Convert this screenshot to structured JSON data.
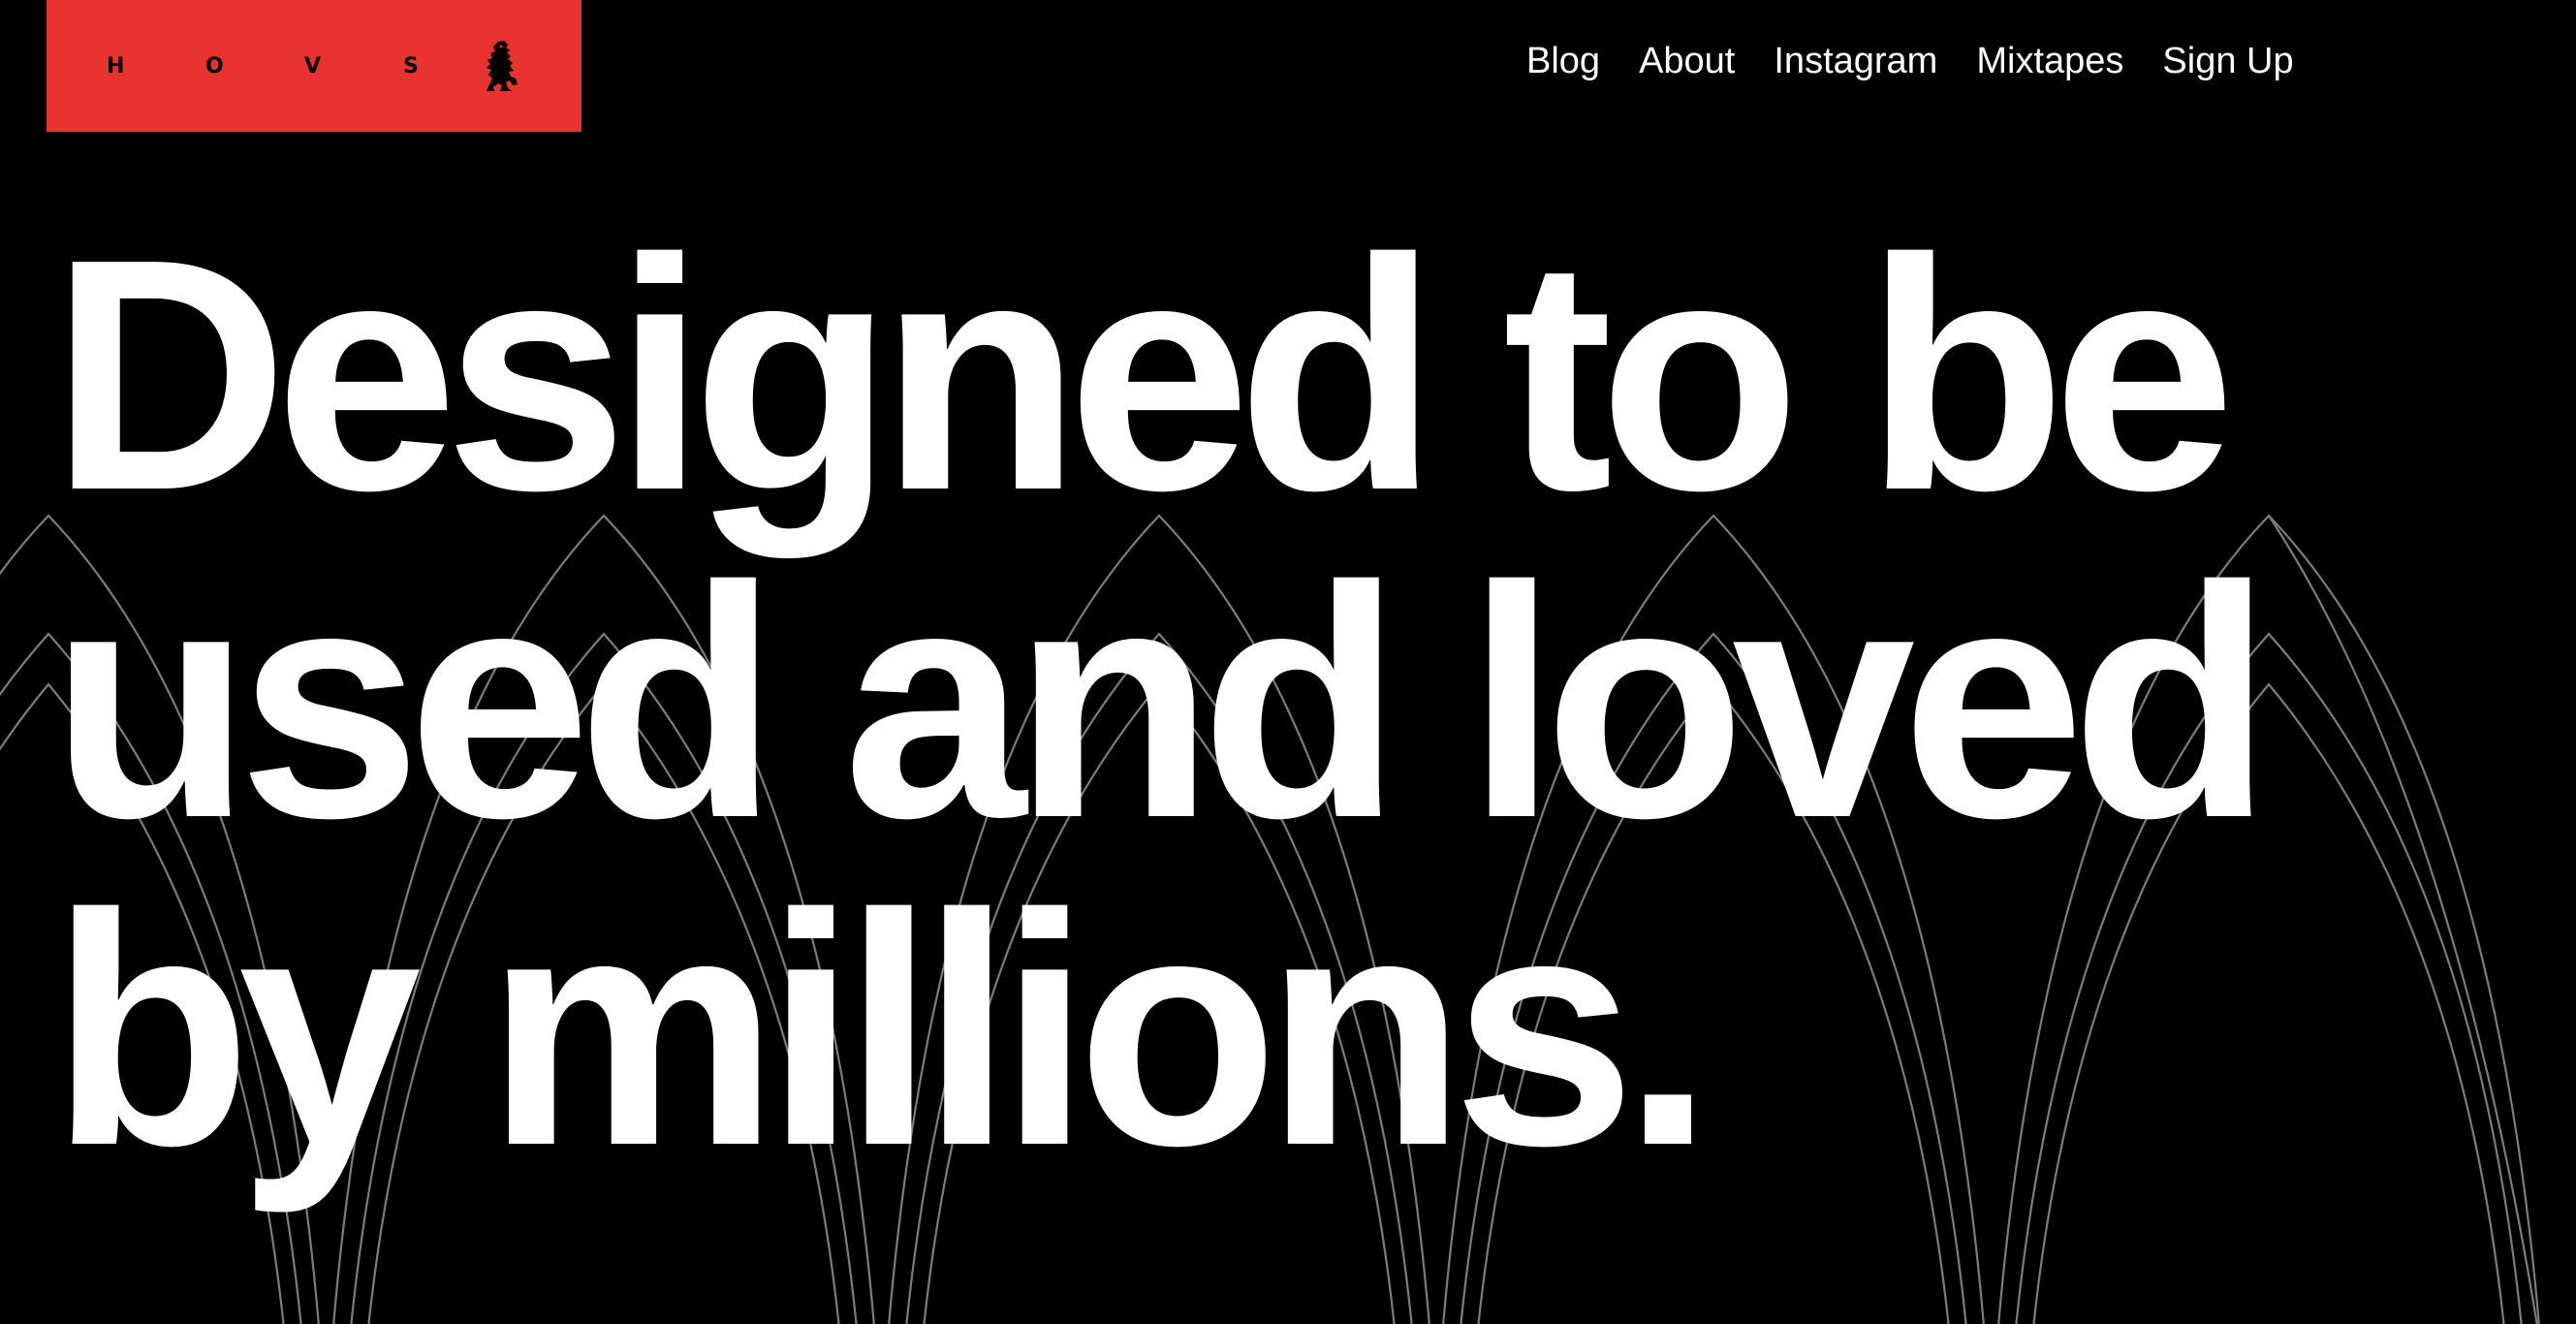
{
  "brand": {
    "letters": [
      "H",
      "O",
      "V",
      "S"
    ],
    "logo_icon": "lion-rampant-icon",
    "logo_color": "#e83330"
  },
  "nav": {
    "items": [
      {
        "label": "Blog"
      },
      {
        "label": "About"
      },
      {
        "label": "Instagram"
      },
      {
        "label": "Mixtapes"
      },
      {
        "label": "Sign Up"
      }
    ]
  },
  "hero": {
    "lines": [
      "Designed to be",
      "used and loved",
      "by millions."
    ]
  },
  "background": {
    "decoration": "line-arches",
    "line_color": "#8a8a8a",
    "page_color": "#000000"
  }
}
